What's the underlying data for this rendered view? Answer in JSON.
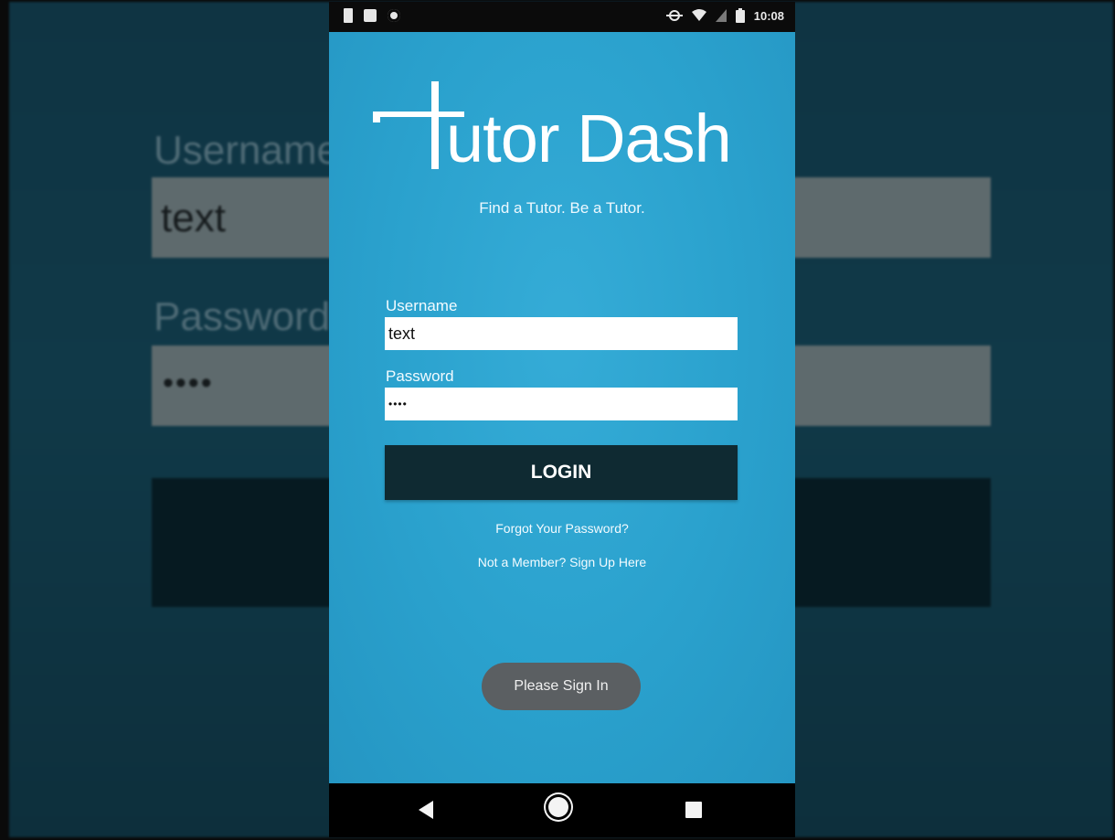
{
  "background": {
    "username_label": "Username",
    "username_value": "text",
    "password_label": "Password",
    "password_value": "••••"
  },
  "status_bar": {
    "time": "10:08"
  },
  "app": {
    "logo_text": "utor Dash",
    "logo_full": "Tutor Dash",
    "tagline": "Find a Tutor. Be a Tutor.",
    "username_label": "Username",
    "username_value": "text",
    "password_label": "Password",
    "password_value": "••••",
    "login_label": "LOGIN",
    "forgot_link": "Forgot Your Password?",
    "signup_link": "Not a Member? Sign Up Here",
    "toast": "Please Sign In"
  },
  "colors": {
    "app_background": "#2aa2cf",
    "login_button": "#0f2a32",
    "toast": "#5b5f62"
  },
  "icons": [
    "notification-icon",
    "image-icon",
    "sync-icon",
    "data-saver-icon",
    "wifi-icon",
    "signal-icon",
    "battery-icon",
    "back-icon",
    "home-icon",
    "recents-icon"
  ]
}
